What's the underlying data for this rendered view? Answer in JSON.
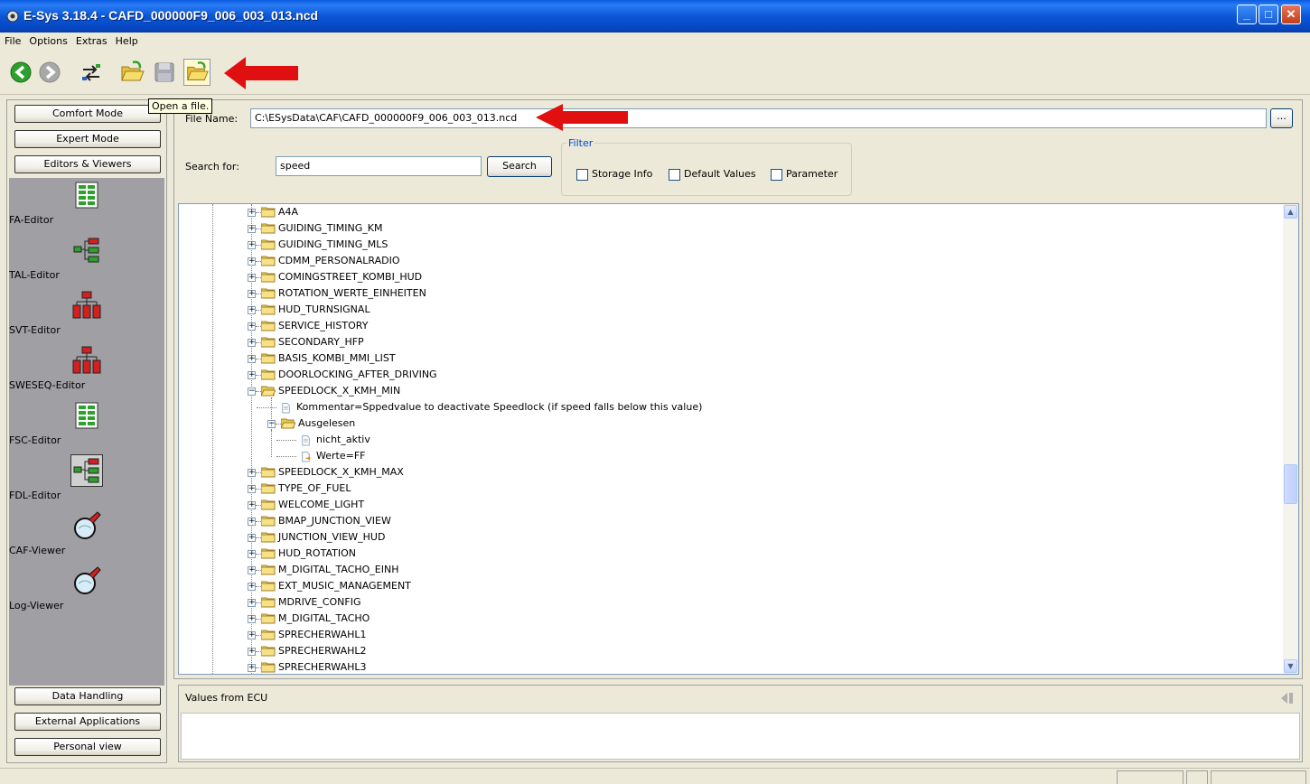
{
  "window": {
    "title": "E-Sys 3.18.4 - CAFD_000000F9_006_003_013.ncd",
    "controls": {
      "minimize": "_",
      "maximize": "□",
      "close": "✕"
    }
  },
  "menu": [
    "File",
    "Options",
    "Extras",
    "Help"
  ],
  "toolbar": {
    "icons": [
      "back-icon",
      "forward-icon",
      "connect-icon",
      "open-folder-icon",
      "save-icon",
      "open-file-icon"
    ],
    "tooltip": "Open a file."
  },
  "sidebar": {
    "top_buttons": [
      "Comfort Mode",
      "Expert Mode",
      "Editors & Viewers"
    ],
    "tools": [
      {
        "label": "FA-Editor",
        "icon": "fa-editor-icon"
      },
      {
        "label": "TAL-Editor",
        "icon": "tal-editor-icon"
      },
      {
        "label": "SVT-Editor",
        "icon": "svt-editor-icon"
      },
      {
        "label": "SWESEQ-Editor",
        "icon": "sweseq-editor-icon"
      },
      {
        "label": "FSC-Editor",
        "icon": "fsc-editor-icon"
      },
      {
        "label": "FDL-Editor",
        "icon": "fdl-editor-icon",
        "selected": true
      },
      {
        "label": "CAF-Viewer",
        "icon": "caf-viewer-icon"
      },
      {
        "label": "Log-Viewer",
        "icon": "log-viewer-icon"
      }
    ],
    "bottom_buttons": [
      "Data Handling",
      "External Applications",
      "Personal view"
    ]
  },
  "main": {
    "file_name_label": "File Name:",
    "file_name_value": "C:\\ESysData\\CAF\\CAFD_000000F9_006_003_013.ncd",
    "browse_label": "...",
    "search_label": "Search for:",
    "search_value": "speed",
    "search_button": "Search",
    "filter": {
      "title": "Filter",
      "options": [
        "Storage Info",
        "Default Values",
        "Parameter"
      ]
    }
  },
  "tree": {
    "nodes": [
      {
        "label": "A4A",
        "type": "folder",
        "level": 0
      },
      {
        "label": "GUIDING_TIMING_KM",
        "type": "folder",
        "level": 0
      },
      {
        "label": "GUIDING_TIMING_MLS",
        "type": "folder",
        "level": 0
      },
      {
        "label": "CDMM_PERSONALRADIO",
        "type": "folder",
        "level": 0
      },
      {
        "label": "COMINGSTREET_KOMBI_HUD",
        "type": "folder",
        "level": 0
      },
      {
        "label": "ROTATION_WERTE_EINHEITEN",
        "type": "folder",
        "level": 0
      },
      {
        "label": "HUD_TURNSIGNAL",
        "type": "folder",
        "level": 0
      },
      {
        "label": "SERVICE_HISTORY",
        "type": "folder",
        "level": 0
      },
      {
        "label": "SECONDARY_HFP",
        "type": "folder",
        "level": 0
      },
      {
        "label": "BASIS_KOMBI_MMI_LIST",
        "type": "folder",
        "level": 0
      },
      {
        "label": "DOORLOCKING_AFTER_DRIVING",
        "type": "folder",
        "level": 0
      },
      {
        "label": "SPEEDLOCK_X_KMH_MIN",
        "type": "folder-open",
        "level": 0
      },
      {
        "label": "Kommentar=Sppedvalue to deactivate Speedlock (if speed falls below this value)",
        "type": "doc",
        "level": 1
      },
      {
        "label": "Ausgelesen",
        "type": "folder-open",
        "level": 1
      },
      {
        "label": "nicht_aktiv",
        "type": "doc",
        "level": 2
      },
      {
        "label": "Werte=FF",
        "type": "doc-arrow",
        "level": 2
      },
      {
        "label": "SPEEDLOCK_X_KMH_MAX",
        "type": "folder",
        "level": 0
      },
      {
        "label": "TYPE_OF_FUEL",
        "type": "folder",
        "level": 0
      },
      {
        "label": "WELCOME_LIGHT",
        "type": "folder",
        "level": 0
      },
      {
        "label": "BMAP_JUNCTION_VIEW",
        "type": "folder",
        "level": 0
      },
      {
        "label": "JUNCTION_VIEW_HUD",
        "type": "folder",
        "level": 0
      },
      {
        "label": "HUD_ROTATION",
        "type": "folder",
        "level": 0
      },
      {
        "label": "M_DIGITAL_TACHO_EINH",
        "type": "folder",
        "level": 0
      },
      {
        "label": "EXT_MUSIC_MANAGEMENT",
        "type": "folder",
        "level": 0
      },
      {
        "label": "MDRIVE_CONFIG",
        "type": "folder",
        "level": 0
      },
      {
        "label": "M_DIGITAL_TACHO",
        "type": "folder",
        "level": 0
      },
      {
        "label": "SPRECHERWAHL1",
        "type": "folder",
        "level": 0
      },
      {
        "label": "SPRECHERWAHL2",
        "type": "folder",
        "level": 0
      },
      {
        "label": "SPRECHERWAHL3",
        "type": "folder",
        "level": 0
      }
    ]
  },
  "values_panel": {
    "title": "Values from ECU"
  },
  "colors": {
    "titlebar": "#0a56d6",
    "face": "#ece9d8",
    "sidebar_gray": "#a0a0a4",
    "annotation_arrow": "#e01010"
  }
}
